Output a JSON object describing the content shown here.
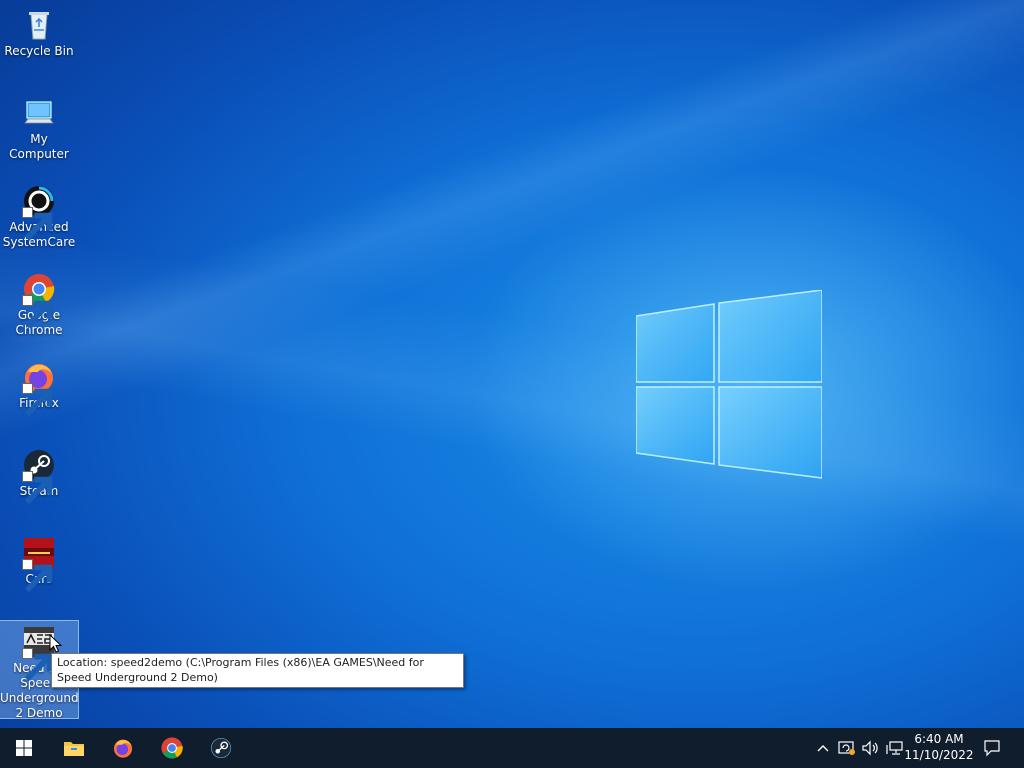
{
  "desktop": {
    "icons": [
      {
        "label": "Recycle Bin",
        "icon": "recycle-bin-icon"
      },
      {
        "label": "My Computer",
        "icon": "computer-icon"
      },
      {
        "label": "Advanced SystemCare",
        "icon": "advanced-systemcare-icon"
      },
      {
        "label": "Google Chrome",
        "icon": "chrome-icon"
      },
      {
        "label": "Firefox",
        "icon": "firefox-icon"
      },
      {
        "label": "Steam",
        "icon": "steam-icon"
      },
      {
        "label": "Cars",
        "icon": "cars-icon"
      },
      {
        "label": "Need for Speed Underground 2 Demo",
        "icon": "nfs-icon"
      }
    ],
    "tooltip": "Location: speed2demo (C:\\Program Files (x86)\\EA GAMES\\Need for Speed Underground 2 Demo)"
  },
  "taskbar": {
    "pinned": [
      "start-icon",
      "file-explorer-icon",
      "firefox-icon",
      "chrome-icon",
      "steam-icon"
    ],
    "tray_icons": [
      "chevron-up-icon",
      "update-icon",
      "volume-icon",
      "network-icon",
      "notifications-icon"
    ],
    "clock": {
      "time": "6:40 AM",
      "date": "11/10/2022"
    }
  },
  "colors": {
    "desktop_blue": "#0f6fd6",
    "taskbar": "#101d2c"
  }
}
